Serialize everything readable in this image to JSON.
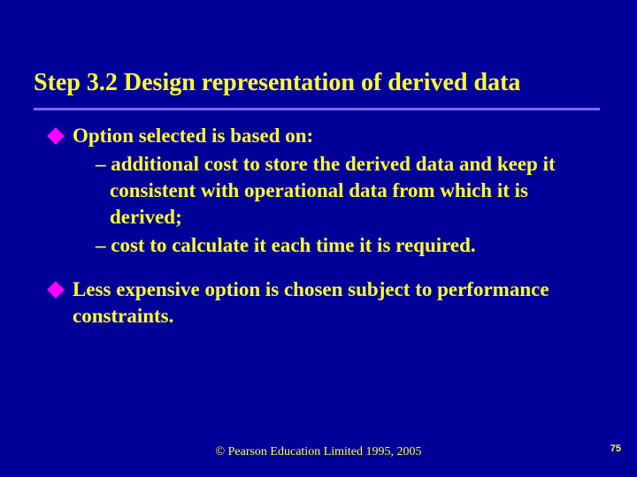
{
  "title": "Step 3.2  Design representation of derived data",
  "bullets": [
    {
      "text": "Option selected is based on:",
      "subs": [
        "– additional cost to store the derived data and keep it consistent with operational data from which it is derived;",
        "– cost to calculate it each time it is required."
      ]
    },
    {
      "text": "Less expensive option is chosen subject to performance constraints.",
      "subs": []
    }
  ],
  "footer": "© Pearson Education Limited 1995, 2005",
  "page_number": "75"
}
